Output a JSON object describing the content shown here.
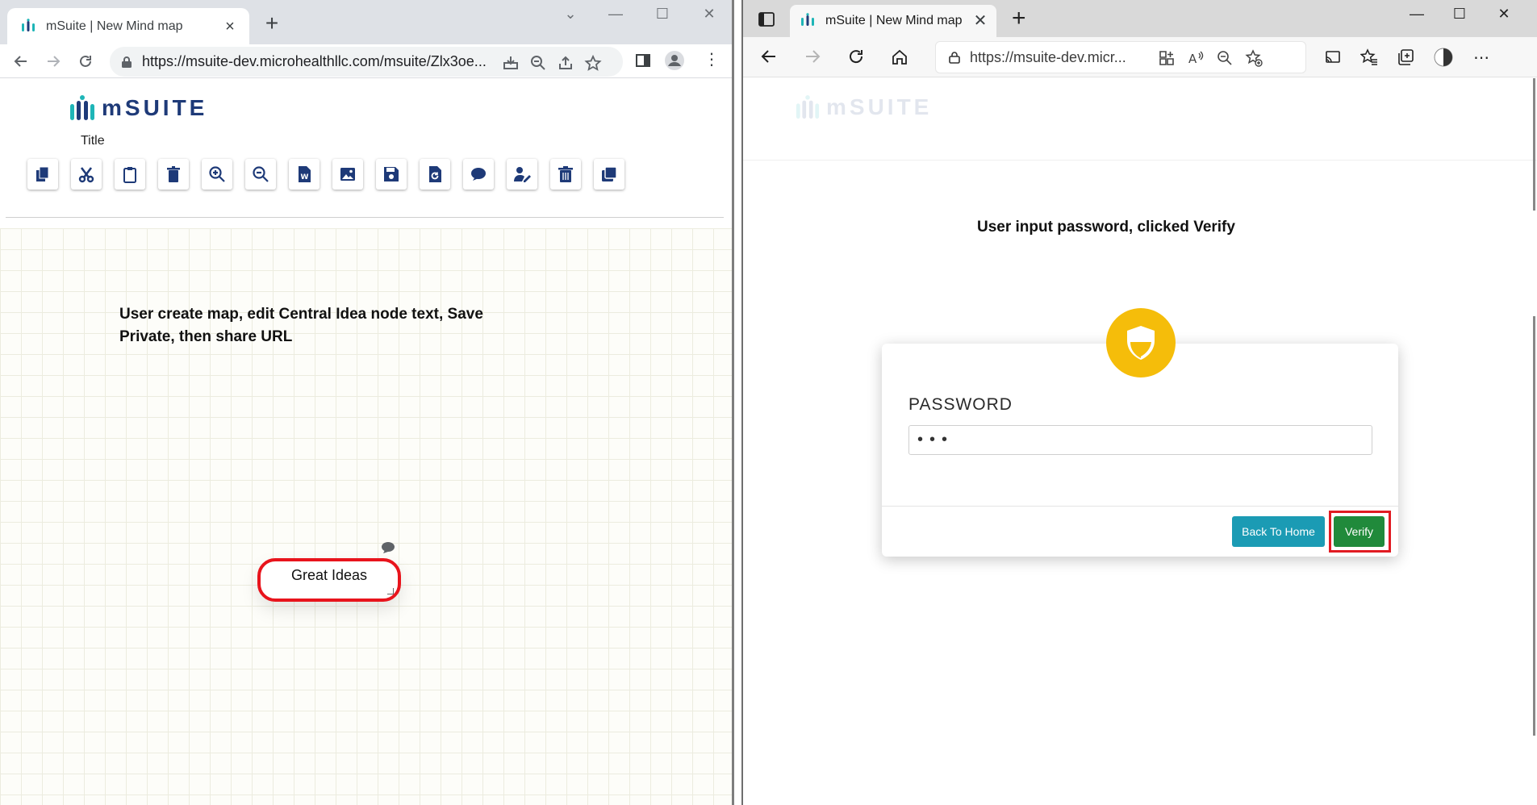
{
  "left_window": {
    "tab_title": "mSuite | New Mind map",
    "url": "https://msuite-dev.microhealthllc.com/msuite/Zlx3oe...",
    "logo_text": "mSUITE",
    "title_label": "Title",
    "toolbar_tools": [
      "copy-icon",
      "cut-icon",
      "paste-icon",
      "delete-icon",
      "zoom-in-icon",
      "zoom-out-icon",
      "word-export-icon",
      "image-export-icon",
      "save-icon",
      "restore-icon",
      "comment-icon",
      "user-edit-icon",
      "trash-icon",
      "layers-icon"
    ],
    "caption": "User create map, edit Central Idea node text, Save Private, then share URL",
    "central_node_text": "Great Ideas"
  },
  "right_window": {
    "tab_title": "mSuite | New Mind map",
    "url": "https://msuite-dev.micr...",
    "logo_text": "mSUITE",
    "caption": "User input password, clicked Verify",
    "password_label": "PASSWORD",
    "password_value": "•••",
    "back_button_label": "Back To Home",
    "verify_button_label": "Verify"
  },
  "colors": {
    "brand_navy": "#1e3a78",
    "brand_teal": "#1eb5b7",
    "shield_yellow": "#f5bd0a",
    "back_button": "#1b9bb4",
    "verify_button": "#208a3b",
    "highlight_red": "#e11b22"
  }
}
